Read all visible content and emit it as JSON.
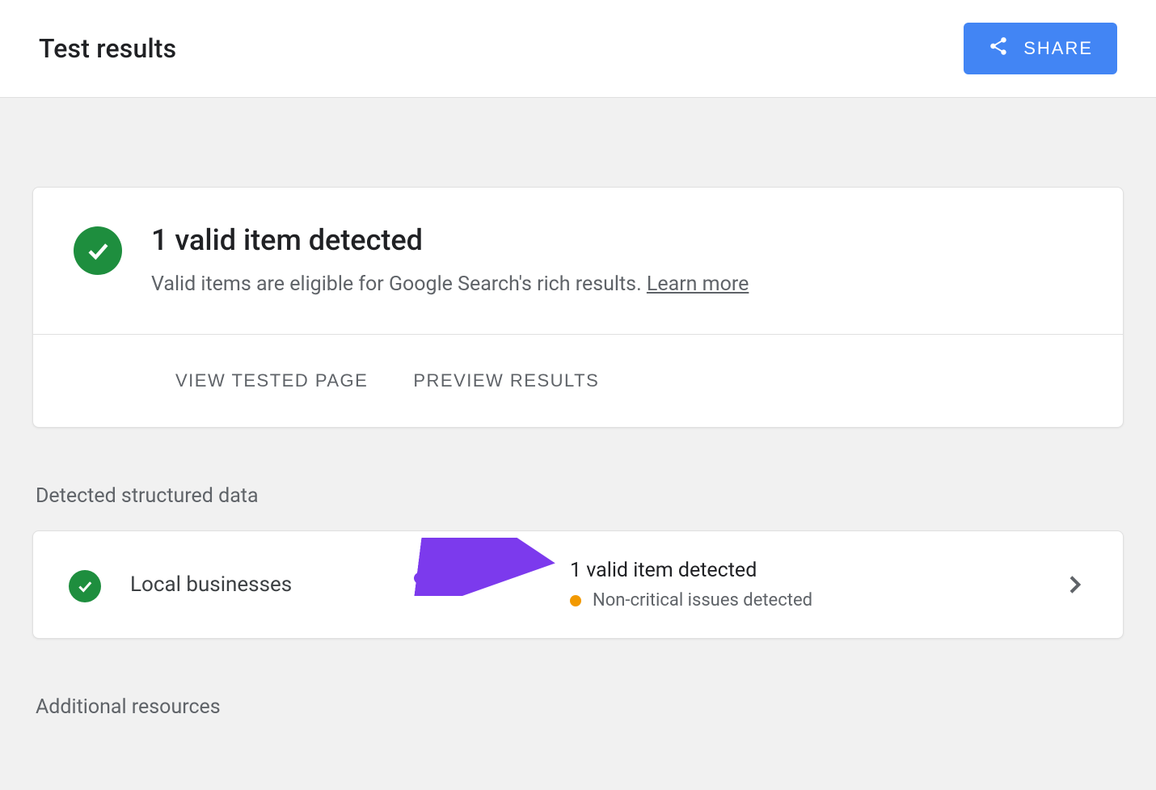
{
  "header": {
    "title": "Test results",
    "share_label": "SHARE"
  },
  "summary": {
    "headline": "1 valid item detected",
    "subtext_prefix": "Valid items are eligible for Google Search's rich results. ",
    "learn_more": "Learn more"
  },
  "actions": {
    "view_tested": "VIEW TESTED PAGE",
    "preview_results": "PREVIEW RESULTS"
  },
  "sections": {
    "detected_label": "Detected structured data",
    "additional_label": "Additional resources"
  },
  "detected_item": {
    "name": "Local businesses",
    "status_line": "1 valid item detected",
    "issue_text": "Non-critical issues detected"
  },
  "colors": {
    "accent_blue": "#4285f4",
    "success_green": "#1e8e3e",
    "warn_orange": "#f29900",
    "annotation_purple": "#7c3aed"
  }
}
